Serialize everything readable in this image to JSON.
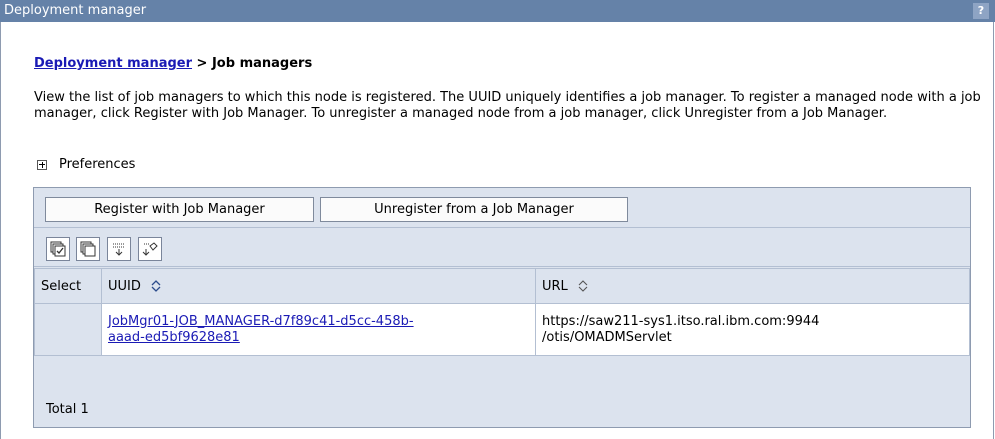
{
  "window": {
    "title": "Deployment manager",
    "help_label": "?"
  },
  "breadcrumb": {
    "link": "Deployment manager",
    "separator": " > ",
    "current": "Job managers"
  },
  "description": "View the list of job managers to which this node is registered. The UUID uniquely identifies a job manager. To register a managed node with a job manager, click Register with Job Manager. To unregister a managed node from a job manager, click Unregister from a Job Manager.",
  "preferences": {
    "label": "Preferences"
  },
  "toolbar": {
    "register_label": "Register with Job Manager",
    "unregister_label": "Unregister from a Job Manager"
  },
  "icons": [
    "select-all-icon",
    "deselect-all-icon",
    "show-filter-icon",
    "clear-filter-icon"
  ],
  "table": {
    "columns": [
      "Select",
      "UUID",
      "URL"
    ],
    "rows": [
      {
        "uuid_line1": "JobMgr01-JOB_MANAGER-d7f89c41-d5cc-458b-",
        "uuid_line2": "aaad-ed5bf9628e81",
        "url_line1": "https://saw211-sys1.itso.ral.ibm.com:9944",
        "url_line2": "/otis/OMADMServlet"
      }
    ],
    "total_label": "Total 1"
  }
}
